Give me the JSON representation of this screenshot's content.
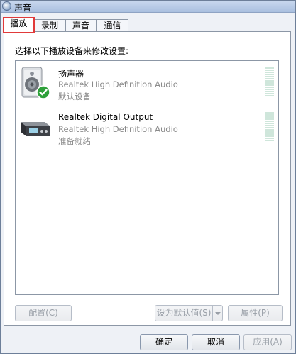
{
  "window": {
    "title": "声音",
    "title_icon": "sound-icon"
  },
  "tabs": [
    {
      "label": "播放",
      "active": true
    },
    {
      "label": "录制",
      "active": false
    },
    {
      "label": "声音",
      "active": false
    },
    {
      "label": "通信",
      "active": false
    }
  ],
  "panel": {
    "instruction": "选择以下播放设备来修改设置:",
    "devices": [
      {
        "name": "扬声器",
        "driver": "Realtek High Definition Audio",
        "status": "默认设备",
        "icon": "speaker-icon",
        "badge": "default-check-icon"
      },
      {
        "name": "Realtek Digital Output",
        "driver": "Realtek High Definition Audio",
        "status": "准备就绪",
        "icon": "digital-output-icon"
      }
    ],
    "configure_label": "配置(C)",
    "set_default_label": "设为默认值(S)",
    "properties_label": "属性(P)"
  },
  "footer": {
    "ok_label": "确定",
    "cancel_label": "取消",
    "apply_label": "应用(A)"
  },
  "colors": {
    "highlight_box": "#e13a3a",
    "check_green": "#2ea03a"
  }
}
